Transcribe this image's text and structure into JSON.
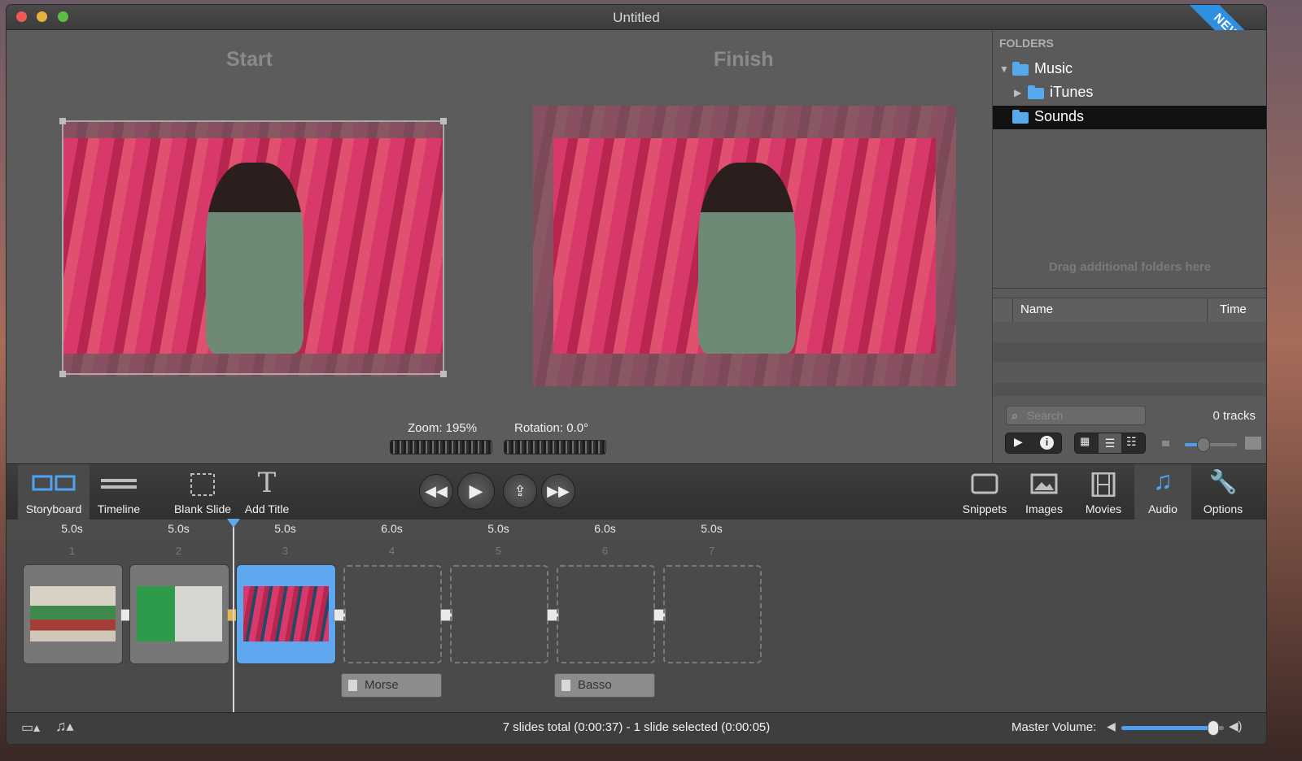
{
  "window": {
    "title": "Untitled",
    "ribbon": "NEWS"
  },
  "preview": {
    "start_label": "Start",
    "finish_label": "Finish",
    "zoom_label": "Zoom: 195%",
    "rotation_label": "Rotation: 0.0°"
  },
  "sidebar": {
    "folders_heading": "FOLDERS",
    "folders": [
      {
        "label": "Music",
        "expanded": true
      },
      {
        "label": "iTunes",
        "expanded": false
      },
      {
        "label": "Sounds",
        "selected": true
      }
    ],
    "drag_hint": "Drag additional folders here",
    "columns": {
      "name": "Name",
      "time": "Time"
    },
    "search_placeholder": "Search",
    "tracks": "0 tracks"
  },
  "toolbar": {
    "storyboard": "Storyboard",
    "timeline": "Timeline",
    "blank_slide": "Blank Slide",
    "add_title": "Add Title",
    "snippets": "Snippets",
    "images": "Images",
    "movies": "Movies",
    "audio": "Audio",
    "options": "Options"
  },
  "slides": [
    {
      "duration": "5.0s",
      "number": "1"
    },
    {
      "duration": "5.0s",
      "number": "2"
    },
    {
      "duration": "5.0s",
      "number": "3"
    },
    {
      "duration": "6.0s",
      "number": "4"
    },
    {
      "duration": "5.0s",
      "number": "5"
    },
    {
      "duration": "6.0s",
      "number": "6"
    },
    {
      "duration": "5.0s",
      "number": "7"
    }
  ],
  "audio_tracks": [
    {
      "label": "Morse"
    },
    {
      "label": "Basso"
    }
  ],
  "status": {
    "summary": "7 slides total (0:00:37)  -  1 slide selected (0:00:05)",
    "master_volume_label": "Master Volume:",
    "master_volume_level": 0.9
  },
  "colors": {
    "accent": "#5fa8f0",
    "window_bg": "#5b5b5b"
  }
}
